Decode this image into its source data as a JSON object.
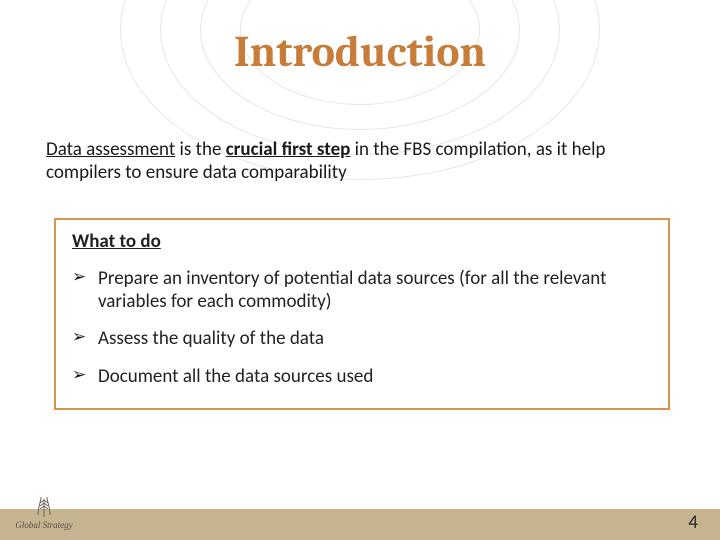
{
  "title": "Introduction",
  "intro": {
    "seg1": "Data assessment",
    "seg2": " is the ",
    "seg3": "crucial first step",
    "seg4": " in the FBS compilation, as it help compilers to ensure data comparability"
  },
  "box": {
    "heading": "What to do",
    "items": [
      "Prepare an inventory of potential data sources (for all the relevant variables for each commodity)",
      "Assess the quality of the data",
      "Document all the data sources used"
    ]
  },
  "footer": {
    "logo_caption": "Global Strategy",
    "page_number": "4"
  },
  "colors": {
    "accent": "#c77c3a",
    "box_border": "#d4964e",
    "footer_bg": "#c6b38f"
  }
}
